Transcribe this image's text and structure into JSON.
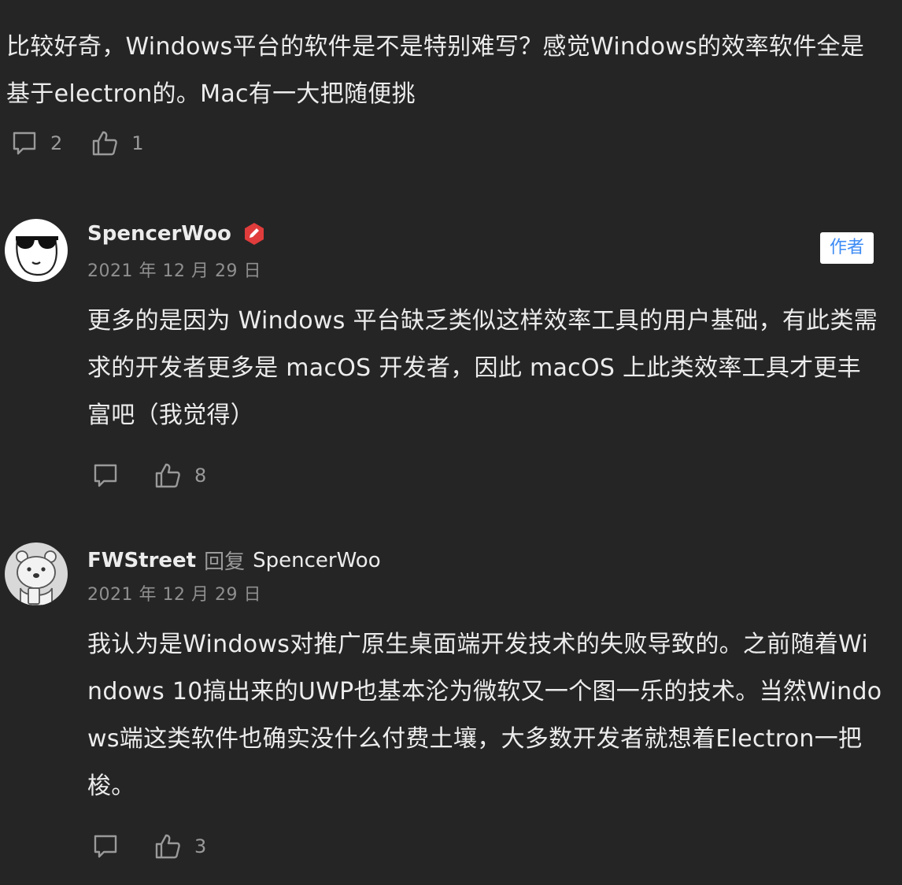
{
  "thread": {
    "root": {
      "text": "比较好奇，Windows平台的软件是不是特别难写？感觉Windows的效率软件全是基于electron的。Mac有一大把随便挑",
      "reply_count": "2",
      "like_count": "1"
    },
    "replies": [
      {
        "author": "SpencerWoo",
        "date": "2021 年 12 月 29 日",
        "author_tag": "作者",
        "text": "更多的是因为 Windows 平台缺乏类似这样效率工具的用户基础，有此类需求的开发者更多是 macOS 开发者，因此 macOS 上此类效率工具才更丰富吧（我觉得）",
        "like_count": "8"
      },
      {
        "author": "FWStreet",
        "reply_word": "回复",
        "reply_to": "SpencerWoo",
        "date": "2021 年 12 月 29 日",
        "text": "我认为是Windows对推广原生桌面端开发技术的失败导致的。之前随着Windows 10搞出来的UWP也基本沦为微软又一个图一乐的技术。当然Windows端这类软件也确实没什么付费土壤，大多数开发者就想着Electron一把梭。",
        "like_count": "3"
      }
    ]
  },
  "icons": {
    "comment": "comment-bubble-icon",
    "like": "thumbs-up-icon",
    "badge": "verified-pen-badge-icon"
  },
  "colors": {
    "background": "#252525",
    "text": "#ececec",
    "muted": "#9a9a9a",
    "author_tag": "#3d8bf5",
    "badge": "#e03c3c"
  }
}
